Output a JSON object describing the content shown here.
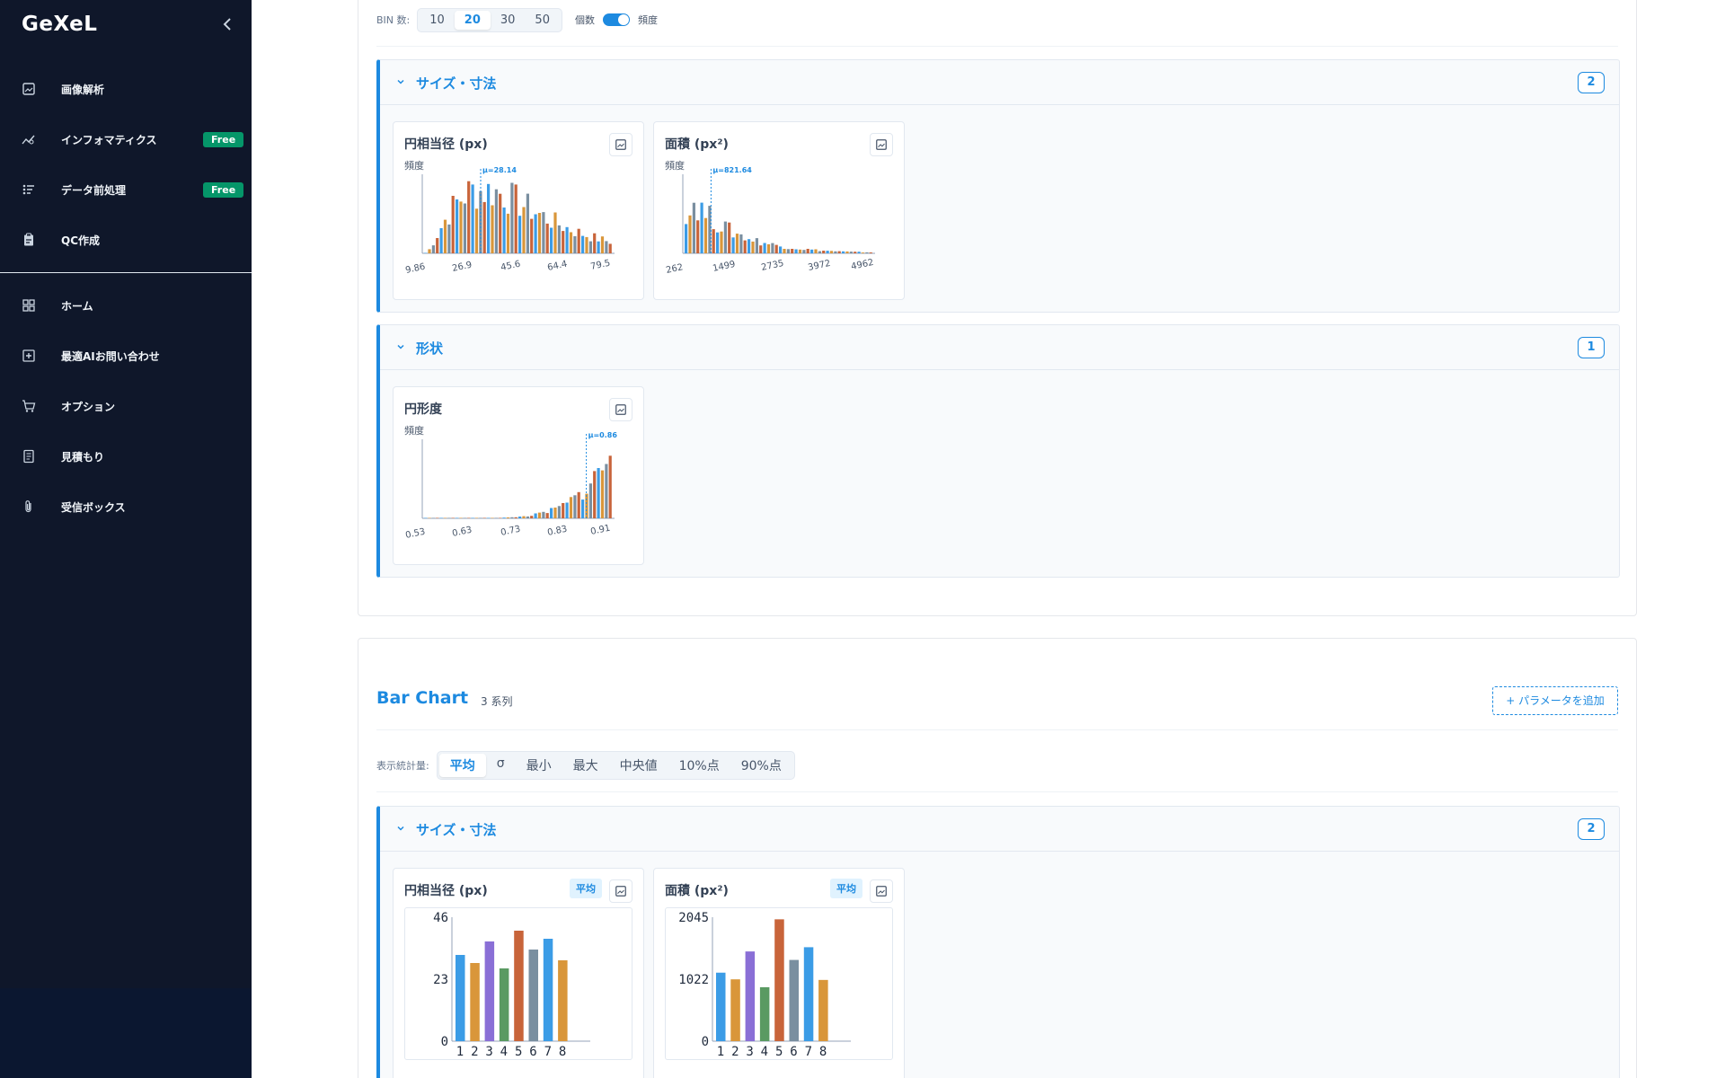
{
  "sidebar": {
    "logo": "GeXeL",
    "items": [
      {
        "label": "画像解析",
        "icon": "image-icon"
      },
      {
        "label": "インフォマティクス",
        "icon": "analytics-icon",
        "badge": "Free"
      },
      {
        "label": "データ前処理",
        "icon": "preprocess-icon",
        "badge": "Free"
      },
      {
        "label": "QC作成",
        "icon": "clipboard-icon"
      },
      {
        "label": "ホーム",
        "icon": "grid-icon"
      },
      {
        "label": "最適AIお問い合わせ",
        "icon": "plus-square-icon"
      },
      {
        "label": "オプション",
        "icon": "cart-icon"
      },
      {
        "label": "見積もり",
        "icon": "document-icon"
      },
      {
        "label": "受信ボックス",
        "icon": "paperclip-icon"
      }
    ]
  },
  "histogram_panel": {
    "bin_label": "BIN 数:",
    "bin_options": [
      "10",
      "20",
      "30",
      "50"
    ],
    "bin_selected": "20",
    "toggle_left": "個数",
    "toggle_right": "頻度",
    "sections": [
      {
        "title": "サイズ・寸法",
        "count": "2",
        "cards": [
          {
            "title": "円相当径 (px)",
            "ylabel": "頻度",
            "mean_label": "μ=28.14",
            "ticks": [
              "9.86",
              "26.9",
              "45.6",
              "64.4",
              "79.5"
            ]
          },
          {
            "title": "面積 (px²)",
            "ylabel": "頻度",
            "mean_label": "μ=821.64",
            "ticks": [
              "262",
              "1499",
              "2735",
              "3972",
              "4962"
            ]
          }
        ]
      },
      {
        "title": "形状",
        "count": "1",
        "cards": [
          {
            "title": "円形度",
            "ylabel": "頻度",
            "mean_label": "μ=0.86",
            "ticks": [
              "0.53",
              "0.63",
              "0.73",
              "0.83",
              "0.91"
            ]
          }
        ]
      }
    ]
  },
  "bar_panel": {
    "title": "Bar Chart",
    "series_count": "3 系列",
    "add_button": "+ パラメータを追加",
    "stat_label": "表示統計量:",
    "stat_options": [
      "平均",
      "σ",
      "最小",
      "最大",
      "中央値",
      "10%点",
      "90%点"
    ],
    "stat_selected": "平均",
    "section": {
      "title": "サイズ・寸法",
      "count": "2"
    },
    "cards": [
      {
        "title": "円相当径 (px)",
        "stat": "平均"
      },
      {
        "title": "面積 (px²)",
        "stat": "平均"
      }
    ]
  },
  "colors": {
    "accent": "#1d8ae0",
    "sidebar_bg": "#0f172a",
    "badge_free": "#059669",
    "series": [
      "#3b9ce6",
      "#d9963a",
      "#8a6fd6",
      "#5a9a62",
      "#c8643a",
      "#7a8fa0",
      "#3b9ce6",
      "#d9963a"
    ]
  },
  "chart_data": [
    {
      "type": "bar",
      "title": "円相当径 (px)",
      "categories": [
        "1",
        "2",
        "3",
        "4",
        "5",
        "6",
        "7",
        "8"
      ],
      "values": [
        32,
        29,
        37,
        27,
        41,
        34,
        38,
        30
      ],
      "ylim": [
        0,
        46
      ],
      "yticks": [
        "0",
        "23",
        "46"
      ]
    },
    {
      "type": "bar",
      "title": "面積 (px²)",
      "categories": [
        "1",
        "2",
        "3",
        "4",
        "5",
        "6",
        "7",
        "8"
      ],
      "values": [
        1130,
        1020,
        1480,
        890,
        2010,
        1340,
        1550,
        1010
      ],
      "ylim": [
        0,
        2045
      ],
      "yticks": [
        "0",
        "1022",
        "2045"
      ]
    }
  ]
}
